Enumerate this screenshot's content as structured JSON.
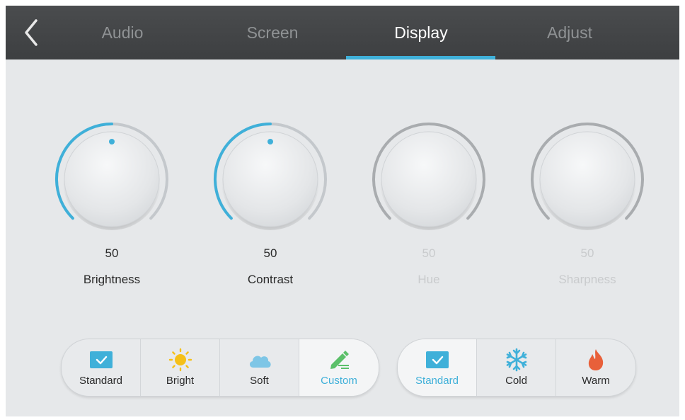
{
  "nav": {
    "back_icon": "chevron-left-icon",
    "tabs": [
      {
        "label": "Audio",
        "active": false
      },
      {
        "label": "Screen",
        "active": false
      },
      {
        "label": "Display",
        "active": true
      },
      {
        "label": "Adjust",
        "active": false
      }
    ]
  },
  "knobs": [
    {
      "label": "Brightness",
      "value": "50",
      "level": 0.5,
      "enabled": true
    },
    {
      "label": "Contrast",
      "value": "50",
      "level": 0.5,
      "enabled": true
    },
    {
      "label": "Hue",
      "value": "50",
      "level": 0.5,
      "enabled": false
    },
    {
      "label": "Sharpness",
      "value": "50",
      "level": 0.5,
      "enabled": false
    }
  ],
  "picture_modes": [
    {
      "label": "Standard",
      "icon": "check-screen-icon",
      "selected": false
    },
    {
      "label": "Bright",
      "icon": "sun-icon",
      "selected": false
    },
    {
      "label": "Soft",
      "icon": "cloud-icon",
      "selected": false
    },
    {
      "label": "Custom",
      "icon": "pencil-edit-icon",
      "selected": true
    }
  ],
  "color_temps": [
    {
      "label": "Standard",
      "icon": "check-screen-icon",
      "selected": true
    },
    {
      "label": "Cold",
      "icon": "snowflake-icon",
      "selected": false
    },
    {
      "label": "Warm",
      "icon": "flame-icon",
      "selected": false
    }
  ],
  "colors": {
    "accent": "#3fb0d9",
    "topbar": "#45474a",
    "background": "#e6e8ea",
    "sun": "#f5c018",
    "cloud": "#7ec6e6",
    "pencil": "#5cc06a",
    "snowflake": "#3fb0d9",
    "flame": "#e8603a"
  }
}
